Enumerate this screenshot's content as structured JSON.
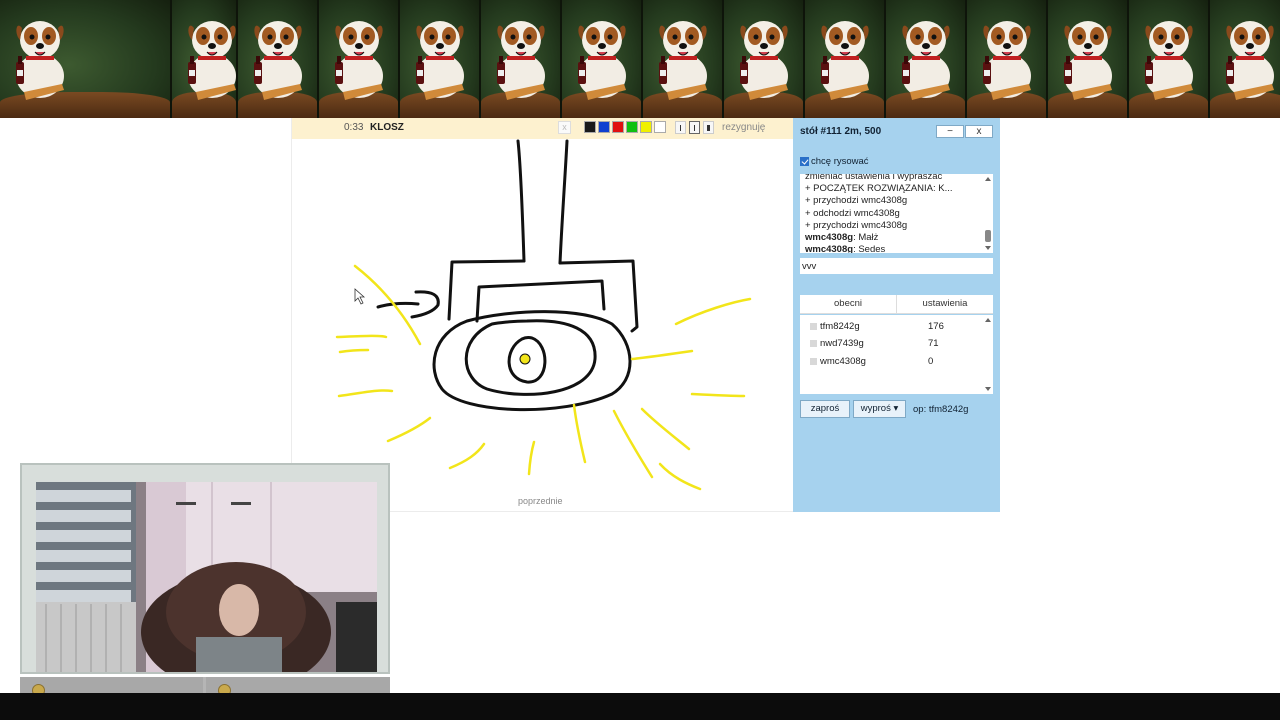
{
  "game": {
    "timer": "0:33",
    "word": "KLOSZ",
    "clear_label": "x",
    "give_up_label": "rezygnuję",
    "previous_label": "poprzednie",
    "colors": [
      "#1a1a1a",
      "#1040d0",
      "#e01010",
      "#10c010",
      "#f0f000",
      "#ffffff"
    ]
  },
  "panel": {
    "title": "stół #111   2m, 500",
    "minimize_label": "−",
    "close_label": "x",
    "want_draw_label": "chcę rysować",
    "chat_lines": [
      {
        "name": "",
        "text": "zmieniać ustawienia i wypraszać"
      },
      {
        "name": "",
        "text": "+ POCZĄTEK ROZWIĄZANIA: K..."
      },
      {
        "name": "",
        "text": "+ przychodzi wmc4308g"
      },
      {
        "name": "",
        "text": "+ odchodzi wmc4308g"
      },
      {
        "name": "",
        "text": "+ przychodzi wmc4308g"
      },
      {
        "name": "wmc4308g",
        "text": ": Małż"
      },
      {
        "name": "wmc4308g",
        "text": ": Sedes"
      }
    ],
    "chat_input_value": "vvv",
    "tabs": [
      "obecni",
      "ustawienia"
    ],
    "players": [
      {
        "name": "tfm8242g",
        "score": "176"
      },
      {
        "name": "nwd7439g",
        "score": "71"
      },
      {
        "name": "wmc4308g",
        "score": "0"
      }
    ],
    "invite_label": "zaproś",
    "kick_label": "wyproś ▾",
    "op_label": "op: tfm8242g"
  }
}
